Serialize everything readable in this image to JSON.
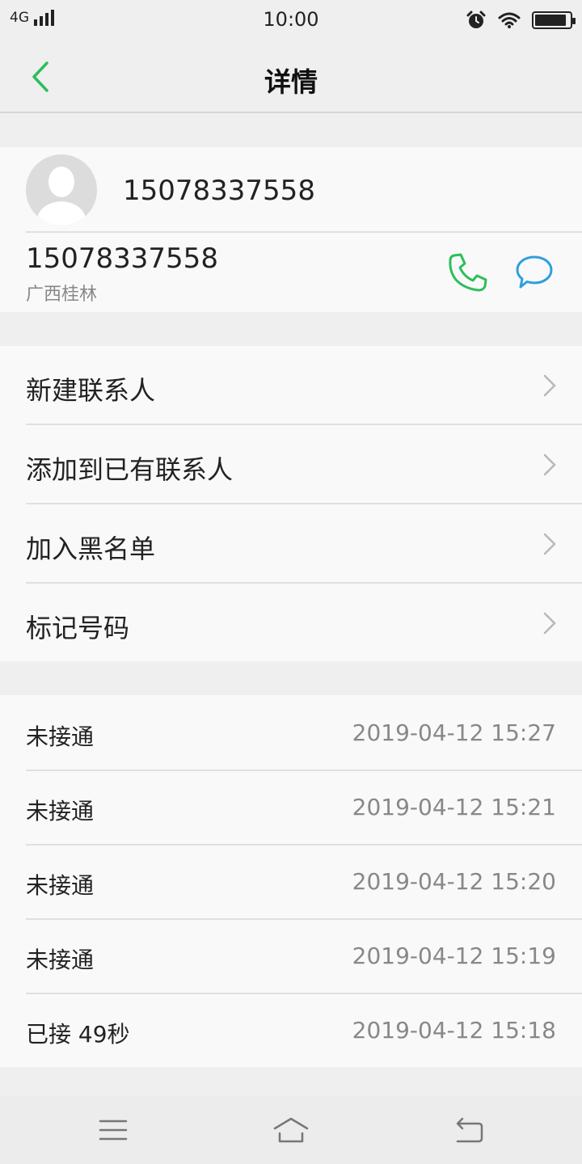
{
  "status_bar": {
    "network": "4G",
    "time": "10:00"
  },
  "header": {
    "title": "详情"
  },
  "contact": {
    "name": "15078337558",
    "number": "15078337558",
    "location": "广西桂林"
  },
  "actions": [
    {
      "label": "新建联系人"
    },
    {
      "label": "添加到已有联系人"
    },
    {
      "label": "加入黑名单"
    },
    {
      "label": "标记号码"
    }
  ],
  "call_history": [
    {
      "status": "未接通",
      "time": "2019-04-12 15:27"
    },
    {
      "status": "未接通",
      "time": "2019-04-12 15:21"
    },
    {
      "status": "未接通",
      "time": "2019-04-12 15:20"
    },
    {
      "status": "未接通",
      "time": "2019-04-12 15:19"
    },
    {
      "status": "已接 49秒",
      "time": "2019-04-12 15:18"
    }
  ],
  "icons": {
    "back": "chevron-left-icon",
    "call": "phone-icon",
    "message": "chat-bubble-icon",
    "menu": "menu-icon",
    "home": "home-icon",
    "return": "return-icon"
  },
  "colors": {
    "accent_green": "#2dbe5c",
    "accent_blue": "#2e9fe0"
  }
}
